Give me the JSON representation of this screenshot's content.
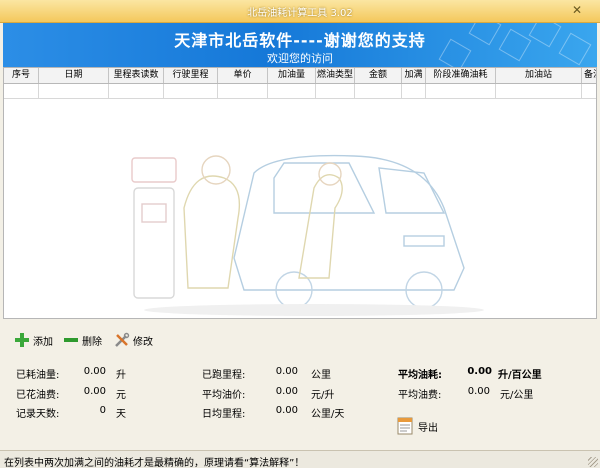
{
  "window": {
    "title": "北岳油耗计算工具 3.02",
    "close_label": "✕"
  },
  "banner": {
    "headline": "天津市北岳软件----谢谢您的支持",
    "subline": "欢迎您的访问"
  },
  "table": {
    "columns": [
      "序号",
      "日期",
      "里程表读数",
      "行驶里程",
      "单价",
      "加油量",
      "燃油类型",
      "金额",
      "加满",
      "阶段准确油耗",
      "加油站",
      "备注"
    ]
  },
  "toolbar": {
    "add_label": "添加",
    "delete_label": "删除",
    "edit_label": "修改"
  },
  "stats": {
    "fuel_used_label": "已耗油量:",
    "fuel_used_value": "0.00",
    "fuel_used_unit": "升",
    "cost_label": "已花油费:",
    "cost_value": "0.00",
    "cost_unit": "元",
    "days_label": "记录天数:",
    "days_value": "0",
    "days_unit": "天",
    "distance_label": "已跑里程:",
    "distance_value": "0.00",
    "distance_unit": "公里",
    "avg_price_label": "平均油价:",
    "avg_price_value": "0.00",
    "avg_price_unit": "元/升",
    "daily_distance_label": "日均里程:",
    "daily_distance_value": "0.00",
    "daily_distance_unit": "公里/天",
    "avg_consumption_label": "平均油耗:",
    "avg_consumption_value": "0.00",
    "avg_consumption_unit": "升/百公里",
    "avg_cost_label": "平均油费:",
    "avg_cost_value": "0.00",
    "avg_cost_unit": "元/公里"
  },
  "export_label": "导出",
  "status": {
    "text": "在列表中两次加满之间的油耗才是最精确的，原理请看“算法解释”！"
  },
  "colors": {
    "banner": "#1a7fdc",
    "titlebar": "#f4c85c",
    "add_icon": "#3aa83a",
    "delete_icon": "#2e9a2e"
  }
}
